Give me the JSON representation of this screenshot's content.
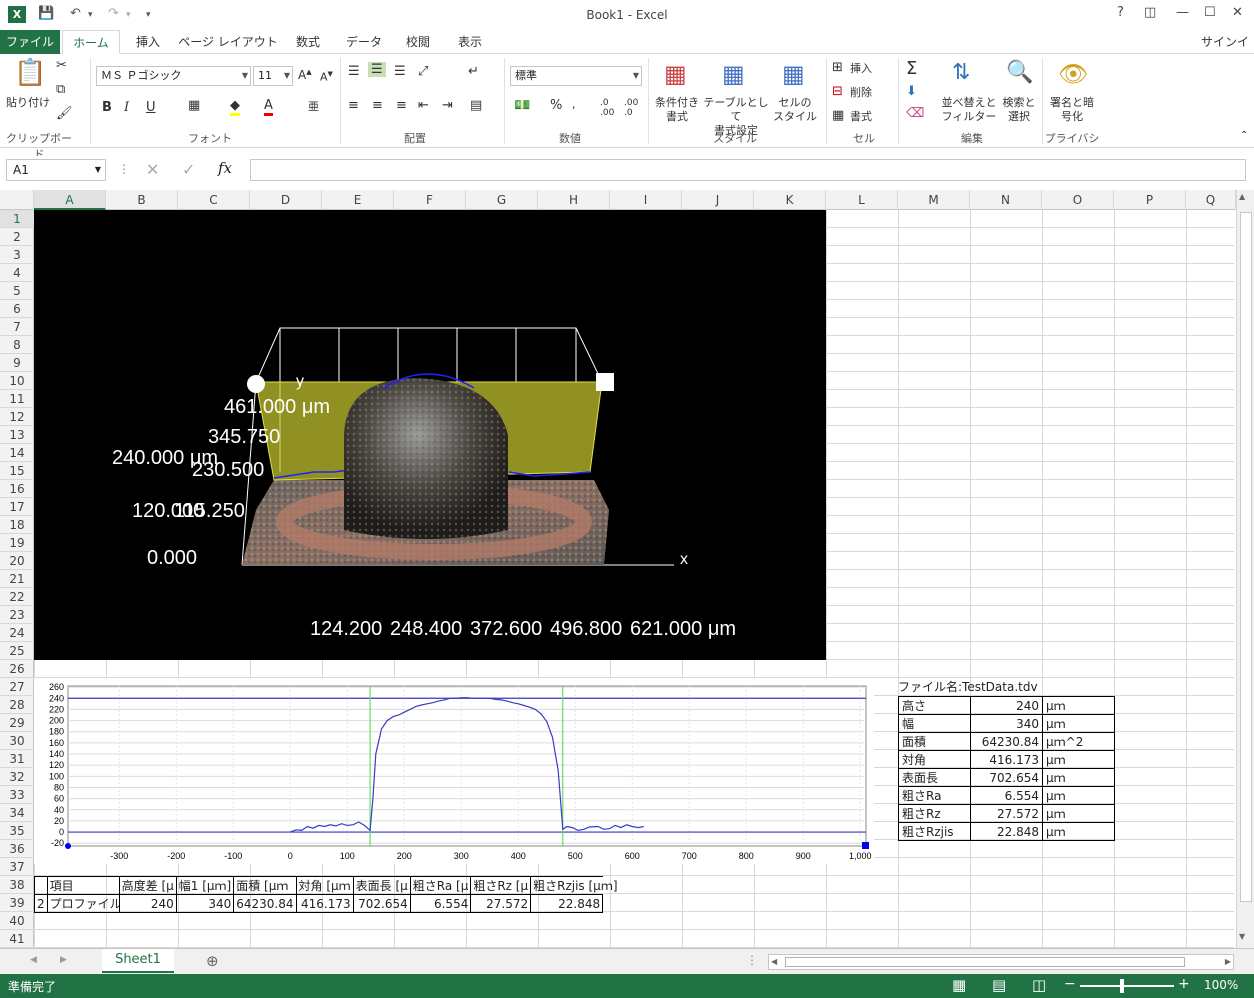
{
  "window": {
    "title": "Book1 - Excel",
    "help": "?",
    "signin": "サインイン"
  },
  "tabs": [
    "ファイル",
    "ホーム",
    "挿入",
    "ページ レイアウト",
    "数式",
    "データ",
    "校閲",
    "表示"
  ],
  "ribbon": {
    "paste": "貼り付け",
    "font_name": "ＭＳ Ｐゴシック",
    "font_size": "11",
    "number_format": "標準",
    "cond_format": [
      "条件付き",
      "書式"
    ],
    "table_format": [
      "テーブルとして",
      "書式設定"
    ],
    "cell_style": [
      "セルの",
      "スタイル"
    ],
    "insert": "挿入",
    "delete": "削除",
    "format": "書式",
    "sort_filter": [
      "並べ替えと",
      "フィルター"
    ],
    "find_select": [
      "検索と",
      "選択"
    ],
    "sign_encrypt": [
      "署名と暗",
      "号化"
    ],
    "groups": {
      "clipboard": "クリップボード",
      "font": "フォント",
      "alignment": "配置",
      "number": "数値",
      "styles": "スタイル",
      "cells": "セル",
      "editing": "編集",
      "privacy": "プライバシ"
    }
  },
  "formula_bar": {
    "name_box": "A1",
    "fx": "fx"
  },
  "columns": [
    "A",
    "B",
    "C",
    "D",
    "E",
    "F",
    "G",
    "H",
    "I",
    "J",
    "K",
    "L",
    "M",
    "N",
    "O",
    "P",
    "Q"
  ],
  "image3d": {
    "z_labels_left": [
      "240.000 μm",
      "120.000",
      "0.000"
    ],
    "y_labels": [
      "461.000 μm",
      "345.750",
      "230.500",
      "115.250"
    ],
    "y_axis": "y",
    "x_axis": "x",
    "x_labels": [
      "124.200",
      "248.400",
      "372.600",
      "496.800",
      "621.000 μm"
    ]
  },
  "profile_chart": {
    "type": "line",
    "y_ticks": [
      260,
      240,
      220,
      200,
      180,
      160,
      140,
      120,
      100,
      80,
      60,
      40,
      20,
      0,
      -20
    ],
    "x_ticks": [
      "-300",
      "-200",
      "-100",
      "0",
      "100",
      "200",
      "300",
      "400",
      "500",
      "600",
      "700",
      "800",
      "900",
      "1,000"
    ],
    "xlim": [
      -390,
      1010
    ],
    "ylim": [
      -25,
      262
    ],
    "ref_lines_y": [
      240,
      0
    ],
    "markers_x": [
      140,
      478
    ],
    "series": [
      {
        "color": "#3a3ac8",
        "points": [
          [
            0,
            0
          ],
          [
            10,
            4
          ],
          [
            20,
            3
          ],
          [
            30,
            10
          ],
          [
            40,
            7
          ],
          [
            50,
            12
          ],
          [
            60,
            10
          ],
          [
            70,
            13
          ],
          [
            80,
            11
          ],
          [
            90,
            15
          ],
          [
            100,
            12
          ],
          [
            110,
            13
          ],
          [
            120,
            18
          ],
          [
            130,
            12
          ],
          [
            140,
            3
          ],
          [
            145,
            60
          ],
          [
            150,
            140
          ],
          [
            160,
            185
          ],
          [
            170,
            200
          ],
          [
            180,
            207
          ],
          [
            190,
            210
          ],
          [
            200,
            215
          ],
          [
            210,
            220
          ],
          [
            220,
            225
          ],
          [
            230,
            228
          ],
          [
            240,
            230
          ],
          [
            250,
            232
          ],
          [
            260,
            235
          ],
          [
            270,
            237
          ],
          [
            280,
            240
          ],
          [
            290,
            240
          ],
          [
            300,
            241
          ],
          [
            310,
            241
          ],
          [
            320,
            240
          ],
          [
            330,
            240
          ],
          [
            340,
            240
          ],
          [
            350,
            240
          ],
          [
            360,
            238
          ],
          [
            370,
            237
          ],
          [
            380,
            235
          ],
          [
            390,
            232
          ],
          [
            400,
            230
          ],
          [
            410,
            227
          ],
          [
            420,
            224
          ],
          [
            430,
            220
          ],
          [
            440,
            212
          ],
          [
            450,
            198
          ],
          [
            460,
            170
          ],
          [
            470,
            110
          ],
          [
            478,
            5
          ],
          [
            485,
            10
          ],
          [
            495,
            8
          ],
          [
            505,
            3
          ],
          [
            515,
            5
          ],
          [
            525,
            9
          ],
          [
            540,
            10
          ],
          [
            550,
            5
          ],
          [
            560,
            6
          ],
          [
            570,
            12
          ],
          [
            580,
            8
          ],
          [
            590,
            13
          ],
          [
            600,
            10
          ],
          [
            610,
            8
          ],
          [
            620,
            10
          ]
        ]
      }
    ]
  },
  "info": {
    "file_label": "ファイル名:TestData.tdv",
    "rows": [
      {
        "name": "高さ",
        "value": "240",
        "unit": "μｍ"
      },
      {
        "name": "幅",
        "value": "340",
        "unit": "μｍ"
      },
      {
        "name": "面積",
        "value": "64230.84",
        "unit": "μｍ^2"
      },
      {
        "name": "対角",
        "value": "416.173",
        "unit": "μｍ"
      },
      {
        "name": "表面長",
        "value": "702.654",
        "unit": "μｍ"
      },
      {
        "name": "粗さRa",
        "value": "6.554",
        "unit": "μｍ"
      },
      {
        "name": "粗さRz",
        "value": "27.572",
        "unit": "μｍ"
      },
      {
        "name": "粗さRzjis",
        "value": "22.848",
        "unit": "μｍ"
      }
    ]
  },
  "summary_table": {
    "headers": [
      "項目",
      "高度差 [μ",
      "幅1 [μｍ]",
      "面積 [μｍ",
      "対角 [μｍ",
      "表面長 [μ",
      "粗さRa [μ",
      "粗さRz [μ",
      "粗さRzjis [μｍ]"
    ],
    "row": [
      "2",
      "プロファイル",
      "240",
      "340",
      "64230.84",
      "416.173",
      "702.654",
      "6.554",
      "27.572",
      "22.848"
    ]
  },
  "sheet_tab": "Sheet1",
  "status": {
    "ready": "準備完了",
    "zoom": "100%"
  },
  "colors": {
    "excel_green": "#217346",
    "selection_yellow": "#c8c830",
    "profile_line": "#3a3ac8",
    "marker_green": "#66dd66"
  }
}
